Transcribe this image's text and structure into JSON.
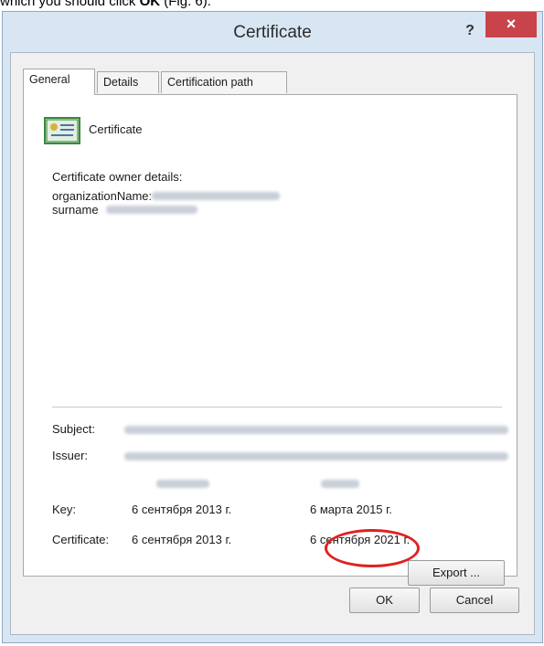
{
  "caption": {
    "prefix": "which you should click ",
    "bold": "OK",
    "suffix": " (Fig. 6)."
  },
  "window": {
    "title": "Certificate",
    "help_label": "?",
    "close_label": "×"
  },
  "tabs": [
    {
      "label": "General",
      "active": true
    },
    {
      "label": "Details",
      "active": false
    },
    {
      "label": "Certification path",
      "active": false
    }
  ],
  "general": {
    "cert_name": "Certificate",
    "owner_heading": "Certificate owner details:",
    "org_label": "organizationName:",
    "surname_label": "surname"
  },
  "info": {
    "subject_label": "Subject:",
    "issuer_label": "Issuer:",
    "key_label": "Key:",
    "key_from": "6 сентября 2013 г.",
    "key_to": "6 марта 2015 г.",
    "cert_label": "Certificate:",
    "cert_from": "6 сентября 2013 г.",
    "cert_to": "6 сентября 2021 г."
  },
  "buttons": {
    "export": "Export ...",
    "ok": "OK",
    "cancel": "Cancel"
  },
  "colors": {
    "close_bg": "#c9434b",
    "highlight": "#e02020",
    "frame": "#d8e6f3"
  }
}
